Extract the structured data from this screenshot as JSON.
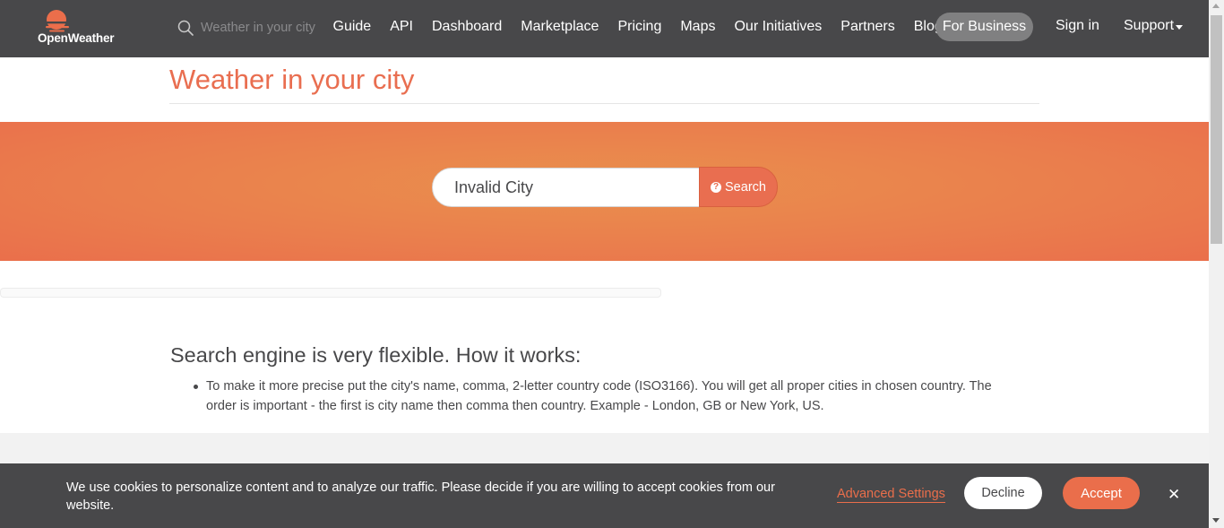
{
  "header": {
    "logo_text": "OpenWeather",
    "search_placeholder": "Weather in your city",
    "nav": [
      "Guide",
      "API",
      "Dashboard",
      "Marketplace",
      "Pricing",
      "Maps",
      "Our Initiatives",
      "Partners",
      "Blog"
    ],
    "for_business": "For Business",
    "sign_in": "Sign in",
    "support": "Support"
  },
  "page": {
    "title": "Weather in your city"
  },
  "search": {
    "value": "Invalid City",
    "button_label": "Search",
    "button_icon": "question-circle-icon"
  },
  "info": {
    "heading": "Search engine is very flexible. How it works:",
    "bullets": [
      "To make it more precise put the city's name, comma, 2-letter country code (ISO3166). You will get all proper cities in chosen country. The order is important - the first is city name then comma then country. Example - London, GB or New York, US."
    ]
  },
  "cookie": {
    "text": "We use cookies to personalize content and to analyze our traffic. Please decide if you are willing to accept cookies from our website.",
    "advanced_settings": "Advanced Settings",
    "decline": "Decline",
    "accept": "Accept",
    "close_icon": "close-icon"
  },
  "colors": {
    "accent": "#e96e50",
    "header_bg": "#48484a",
    "banner": "#ea7d4d",
    "for_business_bg": "#808081"
  }
}
